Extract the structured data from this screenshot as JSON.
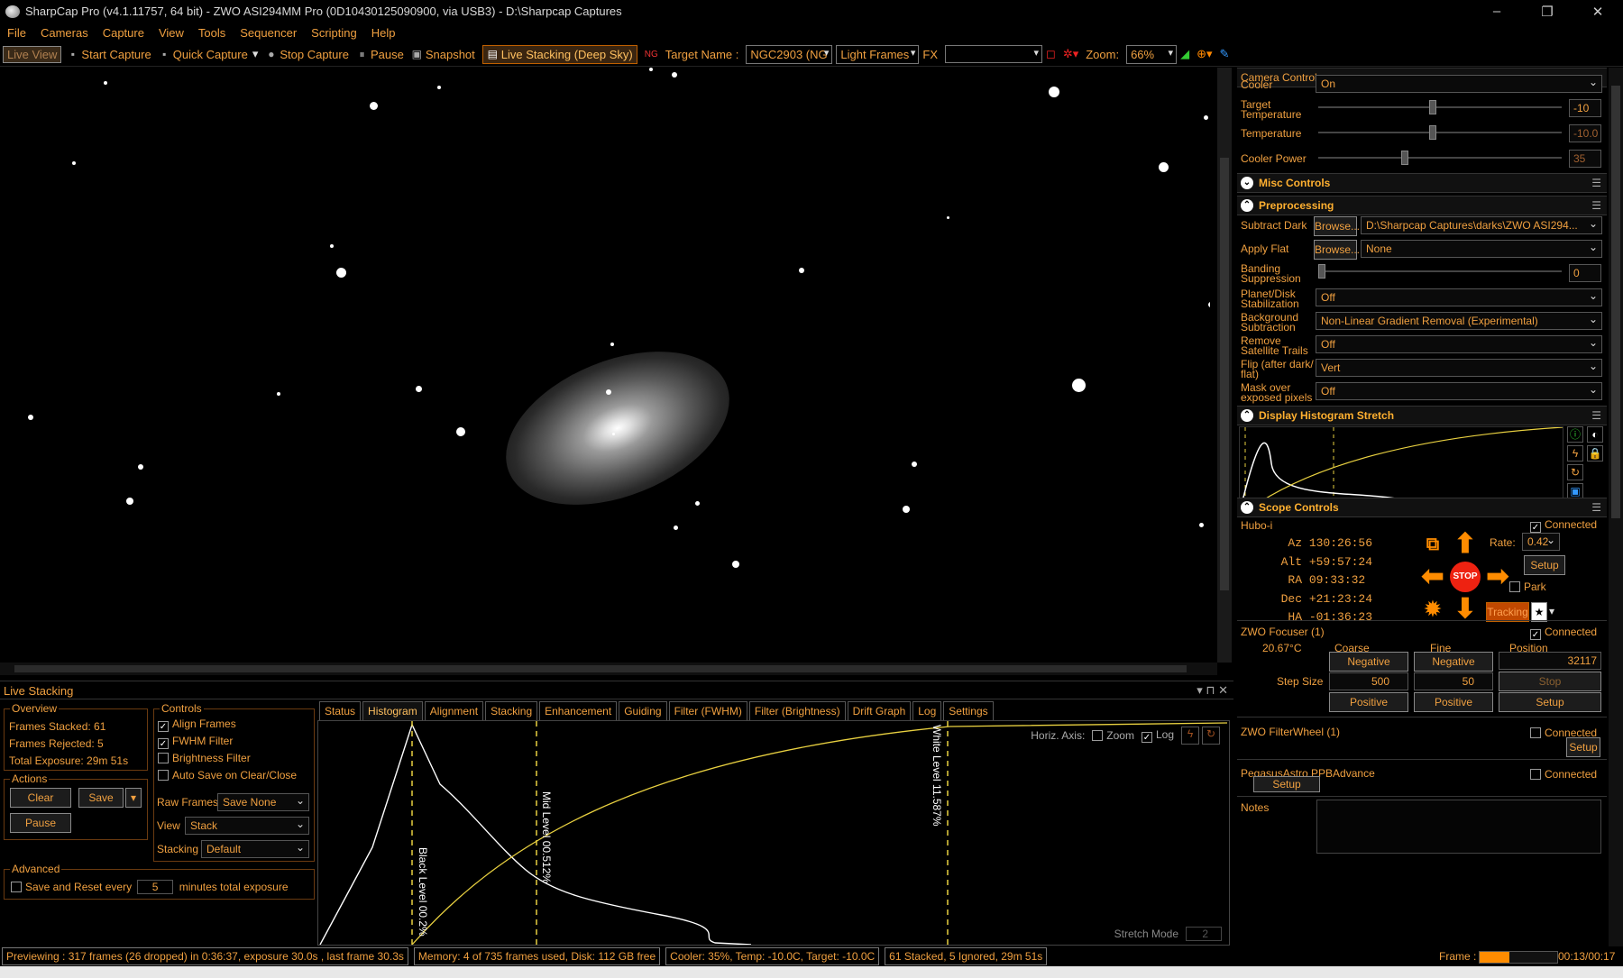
{
  "window": {
    "title": "SharpCap Pro (v4.1.11757, 64 bit) - ZWO ASI294MM Pro (0D10430125090900, via USB3) - D:\\Sharpcap Captures",
    "min": "–",
    "max": "❐",
    "close": "✕"
  },
  "menu": [
    "File",
    "Cameras",
    "Capture",
    "View",
    "Tools",
    "Sequencer",
    "Scripting",
    "Help"
  ],
  "toolbar": {
    "live_view": "Live View",
    "start_capture": "Start Capture",
    "quick_capture": "Quick Capture",
    "stop_capture": "Stop Capture",
    "pause": "Pause",
    "snapshot": "Snapshot",
    "live_stacking": "Live Stacking (Deep Sky)",
    "target_name_label": "Target Name :",
    "target_name": "NGC2903 (NG",
    "frame_type": "Light Frames",
    "fx_label": "FX",
    "fx_value": "",
    "zoom_label": "Zoom:",
    "zoom_value": "66%"
  },
  "camera_controls": {
    "title": "Camera Controls",
    "cooler_label": "Cooler",
    "cooler_value": "On",
    "target_temp_label": "Target Temperature",
    "target_temp_value": "-10",
    "target_temp_level": 0.47,
    "temp_label": "Temperature",
    "temp_value": "-10.0",
    "temp_level": 0.47,
    "cooler_power_label": "Cooler Power",
    "cooler_power_value": "35",
    "cooler_power_level": 0.35
  },
  "misc_controls": {
    "title": "Misc Controls"
  },
  "preprocessing": {
    "title": "Preprocessing",
    "subtract_dark_label": "Subtract Dark",
    "browse": "Browse...",
    "subtract_dark_value": "D:\\Sharpcap Captures\\darks\\ZWO ASI294...",
    "apply_flat_label": "Apply Flat",
    "apply_flat_value": "None",
    "banding_label": "Banding Suppression",
    "banding_value": "0",
    "banding_level": 0,
    "planet_label": "Planet/Disk Stabilization",
    "planet_value": "Off",
    "background_label": "Background Subtraction",
    "background_value": "Non-Linear Gradient Removal (Experimental)",
    "satellite_label": "Remove Satellite Trails",
    "satellite_value": "Off",
    "flip_label": "Flip (after dark/ flat)",
    "flip_value": "Vert",
    "mask_label": "Mask over exposed pixels",
    "mask_value": "Off"
  },
  "histogram_stretch": {
    "title": "Display Histogram Stretch"
  },
  "scope": {
    "title": "Scope Controls",
    "mount": "Hubo-i",
    "connected": "Connected",
    "az_label": "Az",
    "az": "130:26:56",
    "alt_label": "Alt",
    "alt": "+59:57:24",
    "ra_label": "RA",
    "ra": "09:33:32",
    "dec_label": "Dec",
    "dec": "+21:23:24",
    "ha_label": "HA",
    "ha": "-01:36:23",
    "rate_label": "Rate:",
    "rate": "0.42",
    "setup": "Setup",
    "park": "Park",
    "tracking": "Tracking",
    "stop": "STOP"
  },
  "focuser": {
    "title": "ZWO Focuser (1)",
    "connected": "Connected",
    "temp": "20.67°C",
    "coarse": "Coarse",
    "fine": "Fine",
    "position": "Position",
    "negative": "Negative",
    "position_value": "32117",
    "step_size": "Step Size",
    "coarse_step": "500",
    "fine_step": "50",
    "stop": "Stop",
    "positive": "Positive",
    "setup": "Setup"
  },
  "filterwheel": {
    "title": "ZWO FilterWheel (1)",
    "connected": "Connected",
    "setup": "Setup"
  },
  "pegasus": {
    "title": "PegasusAstro PPBAdvance",
    "connected": "Connected",
    "setup": "Setup"
  },
  "notes": {
    "label": "Notes"
  },
  "live_stacking": {
    "title": "Live Stacking",
    "overview": "Overview",
    "frames_stacked": "Frames Stacked:  61",
    "frames_rejected": "Frames Rejected:  5",
    "total_exposure": "Total Exposure:   29m 51s",
    "actions": "Actions",
    "clear": "Clear",
    "save": "Save",
    "pause": "Pause",
    "controls": "Controls",
    "align_frames": "Align Frames",
    "fwhm_filter": "FWHM Filter",
    "brightness_filter": "Brightness Filter",
    "auto_save": "Auto Save on Clear/Close",
    "raw_frames_label": "Raw Frames",
    "raw_frames_value": "Save None",
    "view_label": "View",
    "view_value": "Stack",
    "stacking_label": "Stacking",
    "stacking_value": "Default",
    "advanced": "Advanced",
    "save_reset": "Save and Reset every",
    "save_reset_value": "5",
    "save_reset_suffix": "minutes total exposure",
    "tabs": [
      "Status",
      "Histogram",
      "Alignment",
      "Stacking",
      "Enhancement",
      "Guiding",
      "Filter (FWHM)",
      "Filter (Brightness)",
      "Drift Graph",
      "Log",
      "Settings"
    ],
    "horiz_axis": "Horiz. Axis:",
    "zoom": "Zoom",
    "log": "Log",
    "black_level": "Black Level  00.2%",
    "mid_level": "Mid Level  00.512%",
    "white_level": "White Level  11.587%",
    "stretch_mode": "Stretch Mode",
    "stretch_value": "2"
  },
  "status": {
    "preview": "Previewing : 317 frames (26 dropped) in 0:36:37, exposure 30.0s , last frame 30.3s",
    "memory": "Memory: 4 of 735 frames used, Disk: 112 GB free",
    "cooler": "Cooler: 35%, Temp: -10.0C, Target: -10.0C",
    "stacked": "61 Stacked, 5 Ignored, 29m 51s",
    "frame_label": "Frame :",
    "frame_time": "00:13/00:17",
    "frame_progress": 0.38
  },
  "colors": {
    "accent": "#f0a040",
    "curve": "#e8d040",
    "stop": "#e21"
  }
}
